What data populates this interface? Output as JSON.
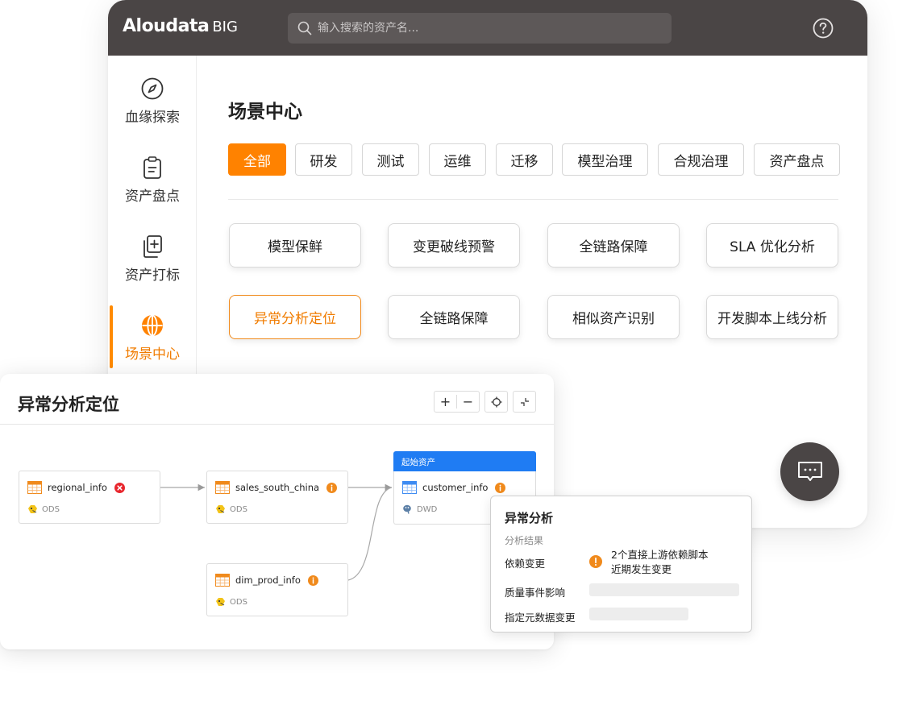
{
  "app": {
    "logo_text": "Aloudata",
    "logo_suffix": "BIG",
    "search_placeholder": "输入搜索的资产名..."
  },
  "sidebar": {
    "items": [
      {
        "label": "血缘探索",
        "icon": "compass-icon"
      },
      {
        "label": "资产盘点",
        "icon": "clipboard-icon"
      },
      {
        "label": "资产打标",
        "icon": "tag-add-icon"
      },
      {
        "label": "场景中心",
        "icon": "globe-icon",
        "active": true
      }
    ]
  },
  "main": {
    "title": "场景中心",
    "filters": [
      "全部",
      "研发",
      "测试",
      "运维",
      "迁移",
      "模型治理",
      "合规治理",
      "资产盘点"
    ],
    "active_filter": "全部",
    "scenes": [
      "模型保鲜",
      "变更破线预警",
      "全链路保障",
      "SLA 优化分析",
      "异常分析定位",
      "全链路保障",
      "相似资产识别",
      "开发脚本上线分析"
    ],
    "active_scene": "异常分析定位"
  },
  "lineage_panel": {
    "title": "异常分析定位",
    "toolbar": {
      "zoom_in": "+",
      "zoom_out": "−"
    },
    "start_tag": "起始资产",
    "nodes": [
      {
        "name": "regional_info",
        "layer": "ODS",
        "status": "error"
      },
      {
        "name": "sales_south_china",
        "layer": "ODS",
        "status": "info"
      },
      {
        "name": "customer_info",
        "layer": "DWD",
        "status": "info",
        "start": true
      },
      {
        "name": "dim_prod_info",
        "layer": "ODS",
        "status": "info"
      }
    ]
  },
  "analysis_popup": {
    "title": "异常分析",
    "subtitle": "分析结果",
    "rows": [
      {
        "label": "依赖变更",
        "desc_line1": "2个直接上游依赖脚本",
        "desc_line2": "近期发生变更"
      },
      {
        "label": "质量事件影响"
      },
      {
        "label": "指定元数据变更"
      }
    ]
  },
  "colors": {
    "accent": "#ff8200",
    "topbar": "#4a4545",
    "start_blue": "#1f7cf3",
    "error": "#e8262d",
    "info": "#f08a1c"
  }
}
